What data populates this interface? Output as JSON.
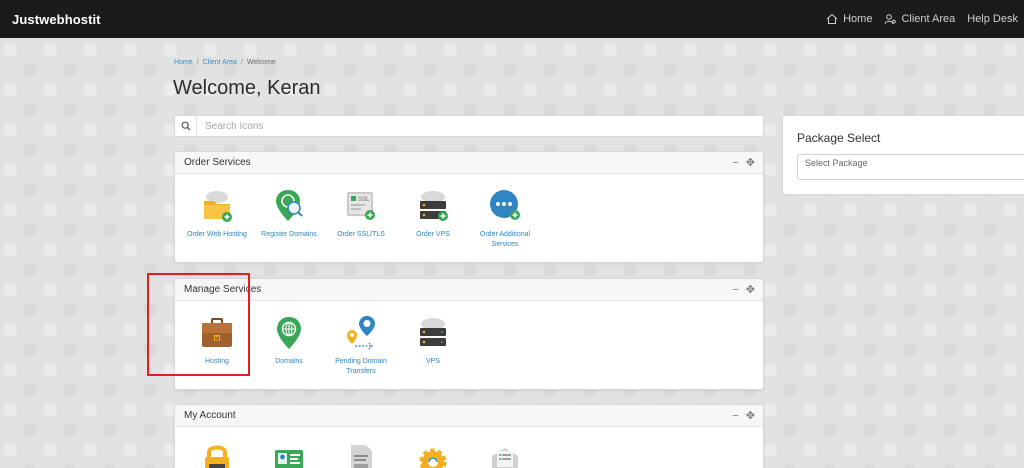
{
  "topbar": {
    "brand": "Justwebhostit",
    "nav": [
      {
        "label": "Home",
        "icon": "home-icon"
      },
      {
        "label": "Client Area",
        "icon": "user-gear-icon"
      },
      {
        "label": "Help Desk"
      }
    ]
  },
  "breadcrumb": [
    "Home",
    "Client Area",
    "Welcome"
  ],
  "page_title": "Welcome, Keran",
  "search": {
    "placeholder": "Search Icons"
  },
  "panels": {
    "order_services": {
      "title": "Order Services",
      "tiles": [
        {
          "label": "Order Web Hosting",
          "icon": "folder-cloud-add-icon"
        },
        {
          "label": "Register Domains",
          "icon": "domain-search-pin-icon"
        },
        {
          "label": "Order SSL/TLS",
          "icon": "ssl-certificate-icon"
        },
        {
          "label": "Order VPS",
          "icon": "server-cloud-add-icon"
        },
        {
          "label": "Order Additional Services",
          "icon": "more-services-add-icon"
        }
      ]
    },
    "manage_services": {
      "title": "Manage Services",
      "tiles": [
        {
          "label": "Hosting",
          "icon": "briefcase-icon"
        },
        {
          "label": "Domains",
          "icon": "globe-pin-icon"
        },
        {
          "label": "Pending Domain Transfers",
          "icon": "domain-transfer-icon"
        },
        {
          "label": "VPS",
          "icon": "server-cloud-icon"
        }
      ]
    },
    "my_account": {
      "title": "My Account",
      "tiles": [
        {
          "icon": "password-lock-icon"
        },
        {
          "icon": "id-card-icon"
        },
        {
          "icon": "invoice-document-icon"
        },
        {
          "icon": "settings-gear-icon"
        },
        {
          "icon": "email-envelope-icon"
        }
      ]
    }
  },
  "package_select": {
    "title": "Package Select",
    "placeholder": "Select Package"
  },
  "colors": {
    "accent_link": "#2f86c2",
    "topbar": "#1b1b1b",
    "highlight": "#e02020"
  }
}
